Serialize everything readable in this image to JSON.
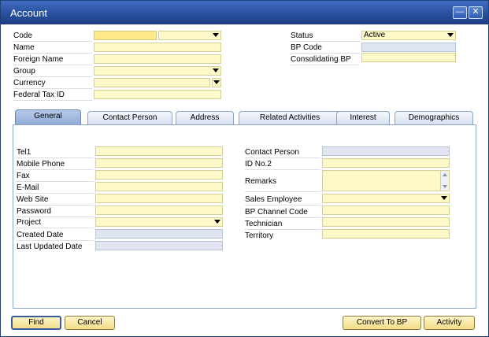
{
  "window": {
    "title": "Account",
    "minimize_icon": "minimize-icon",
    "close_icon": "close-icon"
  },
  "header_left": {
    "code_label": "Code",
    "name_label": "Name",
    "foreign_name_label": "Foreign Name",
    "group_label": "Group",
    "currency_label": "Currency",
    "federal_tax_label": "Federal Tax ID"
  },
  "header_right": {
    "status_label": "Status",
    "status_value": "Active",
    "bp_code_label": "BP Code",
    "consolidating_label": "Consolidating BP"
  },
  "tabs": [
    {
      "label": "General"
    },
    {
      "label": "Contact Person"
    },
    {
      "label": "Address"
    },
    {
      "label": "Related Activities"
    },
    {
      "label": "Interest"
    },
    {
      "label": "Demographics"
    }
  ],
  "general_left": {
    "tel1": "Tel1",
    "mobile": "Mobile Phone",
    "fax": "Fax",
    "email": "E-Mail",
    "website": "Web Site",
    "password": "Password",
    "project": "Project",
    "created": "Created Date",
    "updated": "Last Updated Date"
  },
  "general_right": {
    "contact_person": "Contact Person",
    "id_no2": "ID No.2",
    "remarks": "Remarks",
    "sales_employee": "Sales Employee",
    "bp_channel": "BP Channel Code",
    "technician": "Technician",
    "territory": "Territory"
  },
  "buttons": {
    "find": "Find",
    "cancel": "Cancel",
    "convert": "Convert To BP",
    "activity": "Activity"
  }
}
